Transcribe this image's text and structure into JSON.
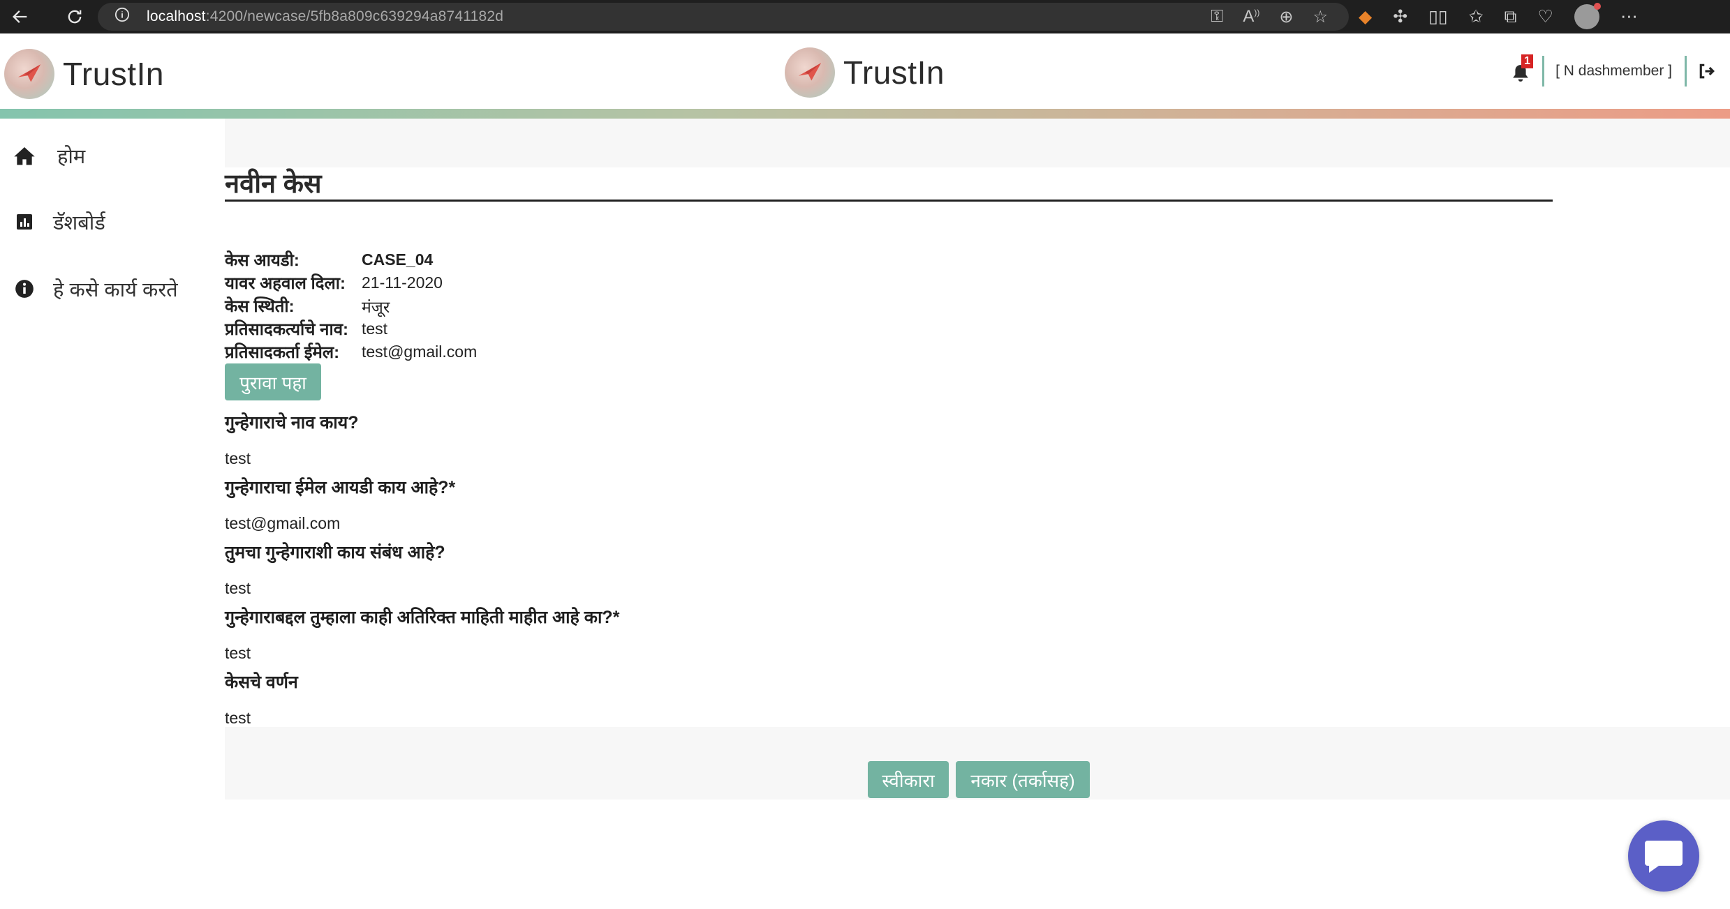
{
  "browser": {
    "url_host": "localhost",
    "url_path": ":4200/newcase/5fb8a809c639294a8741182d"
  },
  "header": {
    "brand_left": "TrustIn",
    "brand_center": "TrustIn",
    "notification_count": "1",
    "user_label": "[ N dashmember ]"
  },
  "sidebar": {
    "items": [
      {
        "label": "होम",
        "icon": "home-icon"
      },
      {
        "label": "डॅशबोर्ड",
        "icon": "bar-chart-icon"
      },
      {
        "label": "हे कसे कार्य करते",
        "icon": "info-icon"
      }
    ]
  },
  "main": {
    "title": "नवीन केस",
    "meta": [
      {
        "key": "केस आयडी:",
        "value": "CASE_04"
      },
      {
        "key": "यावर अहवाल दिला:",
        "value": "21-11-2020"
      },
      {
        "key": "केस स्थिती:",
        "value": "मंजूर"
      },
      {
        "key": "प्रतिसादकर्त्याचे नाव:",
        "value": "test"
      },
      {
        "key": "प्रतिसादकर्ता ईमेल:",
        "value": "test@gmail.com"
      }
    ],
    "evidence_button": "पुरावा पहा",
    "qa": [
      {
        "q": "गुन्हेगाराचे नाव काय?",
        "a": "test"
      },
      {
        "q": "गुन्हेगाराचा ईमेल आयडी काय आहे?*",
        "a": "test@gmail.com"
      },
      {
        "q": "तुमचा गुन्हेगाराशी काय संबंध आहे?",
        "a": "test"
      },
      {
        "q": "गुन्हेगाराबद्दल तुम्हाला काही अतिरिक्त माहिती माहीत आहे का?*",
        "a": "test"
      },
      {
        "q": "केसचे वर्णन",
        "a": "test"
      }
    ],
    "accept_button": "स्वीकारा",
    "reject_button": "नकार (तर्कासह)"
  },
  "colors": {
    "accent_green": "#73b3a1",
    "chat_purple": "#5b5fc7",
    "badge_red": "#d62424"
  }
}
